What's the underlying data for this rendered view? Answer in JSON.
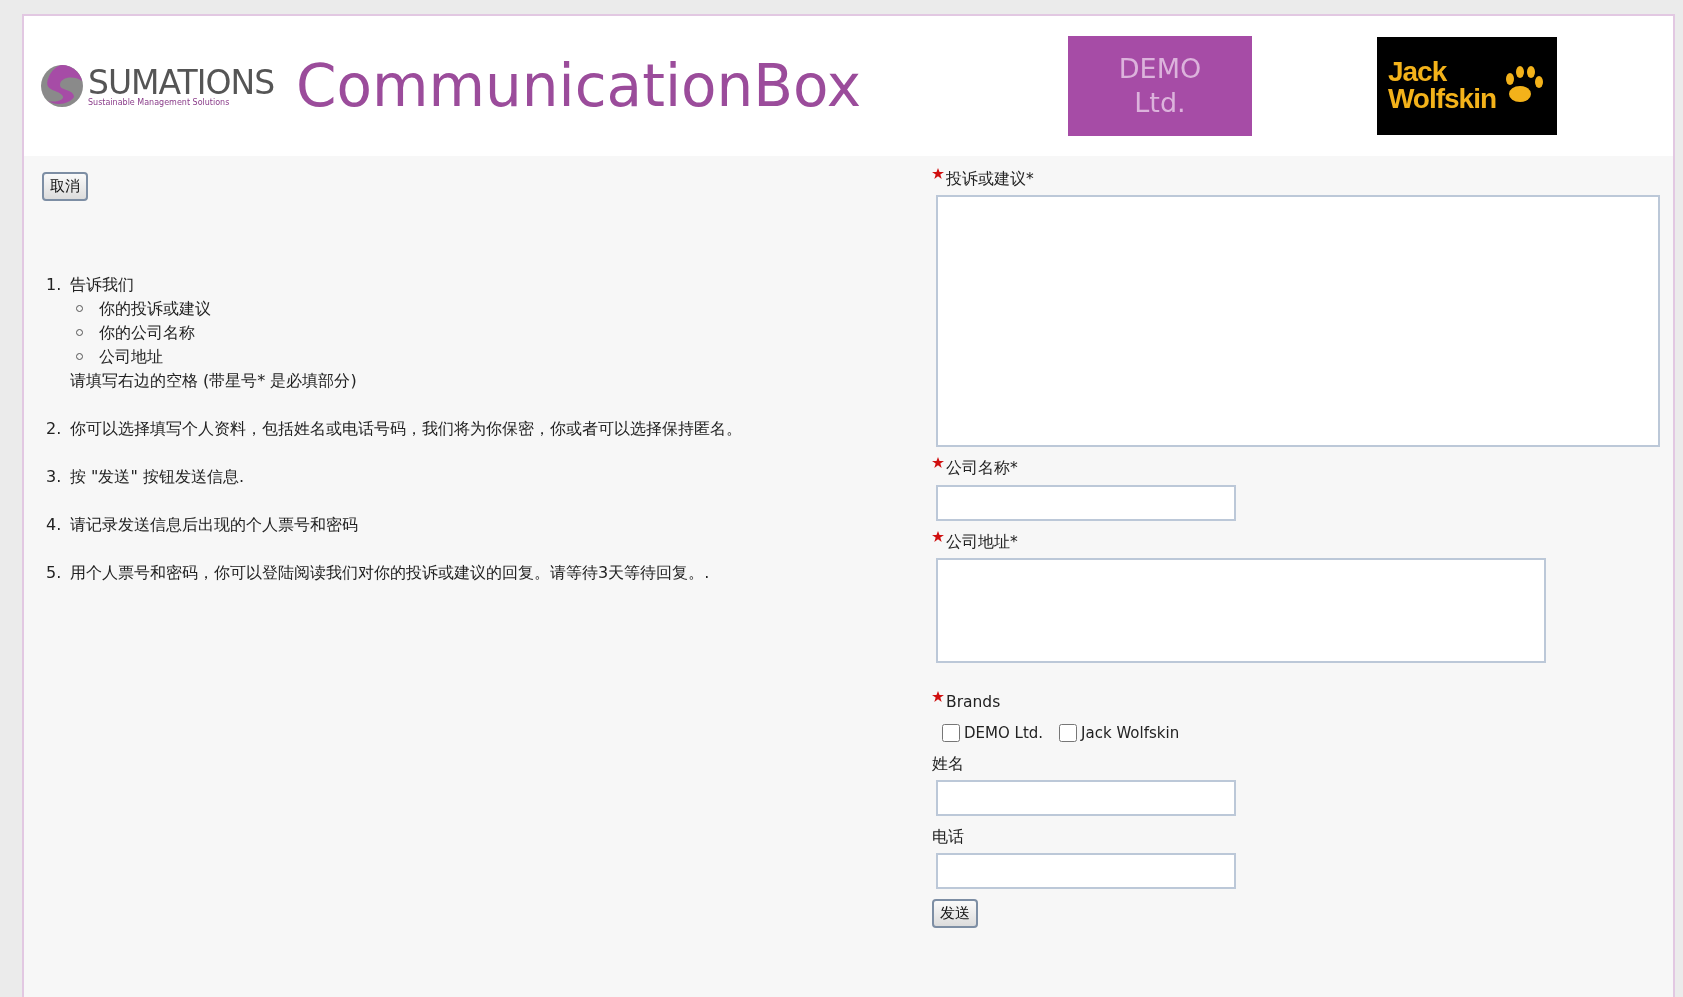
{
  "header": {
    "logo": {
      "name": "SUMATIONS",
      "tagline": "Sustainable Management Solutions"
    },
    "title": "CommunicationBox",
    "brand_logos": [
      {
        "kind": "demo",
        "lines": [
          "DEMO",
          "Ltd."
        ]
      },
      {
        "kind": "wolfskin",
        "lines": [
          "Jack",
          "Wolfskin"
        ]
      }
    ]
  },
  "cancel_button": "取消",
  "instructions": [
    {
      "number": "1.",
      "text": "告诉我们",
      "items": [
        "你的投诉或建议",
        "你的公司名称",
        "公司地址"
      ],
      "note": "请填写右边的空格 (带星号* 是必填部分)"
    },
    {
      "number": "2.",
      "text": "你可以选择填写个人资料，包括姓名或电话号码，我们将为你保密，你或者可以选择保持匿名。"
    },
    {
      "number": "3.",
      "text": "按 \"发送\" 按钮发送信息."
    },
    {
      "number": "4.",
      "text": "请记录发送信息后出现的个人票号和密码"
    },
    {
      "number": "5.",
      "text": "用个人票号和密码，你可以登陆阅读我们对你的投诉或建议的回复。请等待3天等待回复。."
    }
  ],
  "form": [
    {
      "kind": "bigtextarea",
      "label": "投诉或建议*",
      "required": true
    },
    {
      "kind": "input",
      "label": "公司名称*",
      "required": true
    },
    {
      "kind": "textarea",
      "label": "公司地址*",
      "required": true
    },
    {
      "kind": "checkboxes",
      "label": "Brands",
      "required": true,
      "options": [
        {
          "label": "DEMO Ltd.",
          "checked": false
        },
        {
          "label": "Jack Wolfskin",
          "checked": false
        }
      ]
    },
    {
      "kind": "input",
      "label": "姓名",
      "required": false
    },
    {
      "kind": "input",
      "label": "电话",
      "required": false
    }
  ],
  "submit_button": "发送"
}
